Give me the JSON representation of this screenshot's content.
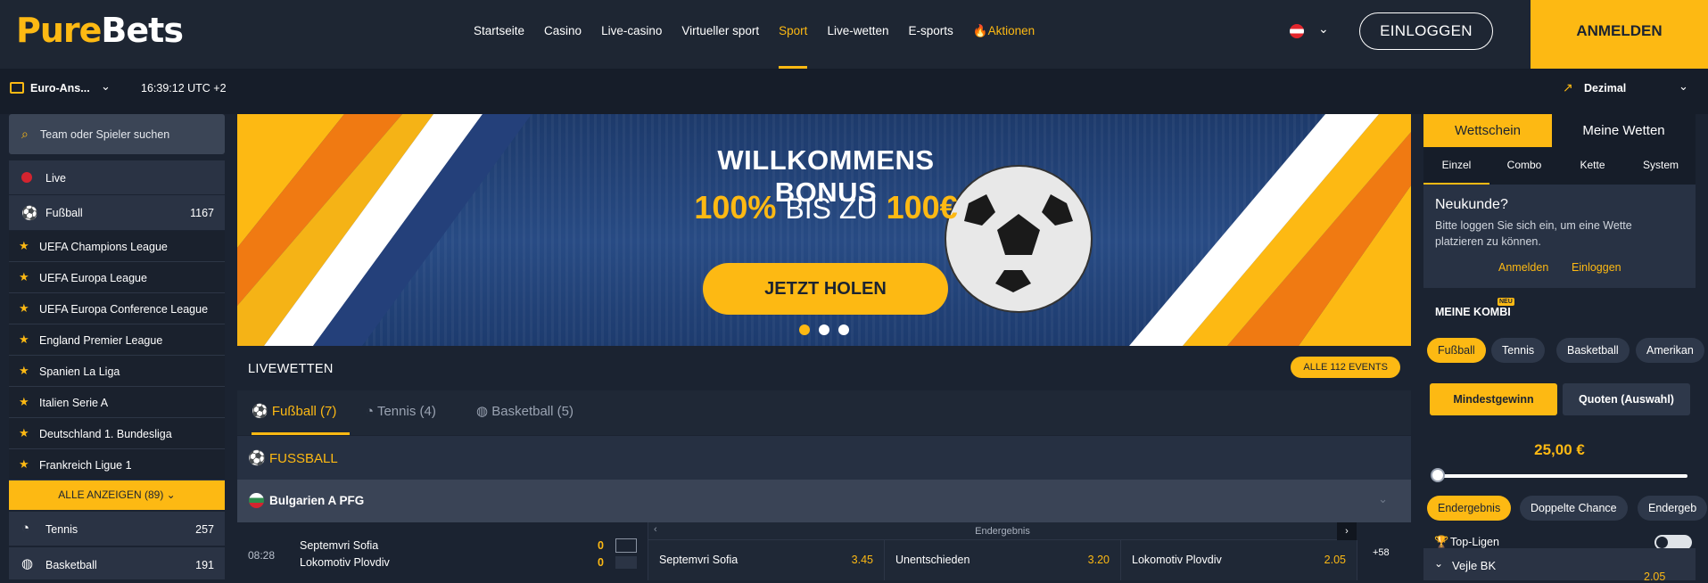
{
  "logo": {
    "part1": "Pure",
    "part2": "Bets"
  },
  "nav": [
    {
      "label": "Startseite"
    },
    {
      "label": "Casino"
    },
    {
      "label": "Live-casino"
    },
    {
      "label": "Virtueller sport"
    },
    {
      "label": "Sport",
      "active": true
    },
    {
      "label": "Live-wetten"
    },
    {
      "label": "E-sports"
    },
    {
      "label": "Aktionen",
      "icon": "fire-icon"
    }
  ],
  "header": {
    "login_label": "EINLOGGEN",
    "signup_label": "ANMELDEN"
  },
  "subbar": {
    "odds_format": "Euro-Ans...",
    "time": "16:39:12 UTC +2",
    "decimal": "Dezimal"
  },
  "sidebar": {
    "search_placeholder": "Team oder Spieler suchen",
    "live_label": "Live",
    "football": {
      "label": "Fußball",
      "count": "1167"
    },
    "leagues": [
      "UEFA Champions League",
      "UEFA Europa League",
      "UEFA Europa Conference League",
      "England Premier League",
      "Spanien La Liga",
      "Italien Serie A",
      "Deutschland 1. Bundesliga",
      "Frankreich Ligue 1"
    ],
    "show_all": "ALLE ANZEIGEN (89)",
    "tennis": {
      "label": "Tennis",
      "count": "257"
    },
    "basketball": {
      "label": "Basketball",
      "count": "191"
    }
  },
  "banner": {
    "title": "WILLKOMMENS BONUS",
    "offer_pct": "100%",
    "offer_mid": "BIS ZU",
    "offer_amount": "100€",
    "cta": "JETZT HOLEN",
    "dots_active": 1
  },
  "live": {
    "title": "LIVEWETTEN",
    "all_events": "ALLE 112 EVENTS",
    "tabs": [
      {
        "label": "Fußball (7)",
        "active": true
      },
      {
        "label": "Tennis (4)"
      },
      {
        "label": "Basketball (5)"
      }
    ],
    "section_title": "FUSSBALL",
    "league": "Bulgarien A PFG",
    "match": {
      "time": "08:28",
      "home": "Septemvri Sofia",
      "away": "Lokomotiv Plovdiv",
      "home_score": "0",
      "away_score": "0",
      "market": "Endergebnis",
      "odds": [
        {
          "name": "Septemvri Sofia",
          "value": "3.45"
        },
        {
          "name": "Unentschieden",
          "value": "3.20"
        },
        {
          "name": "Lokomotiv Plovdiv",
          "value": "2.05"
        }
      ],
      "more": "+58"
    }
  },
  "betslip": {
    "tabs": [
      "Wettschein",
      "Meine Wetten"
    ],
    "subtabs": [
      "Einzel",
      "Combo",
      "Kette",
      "System"
    ],
    "new_customer_title": "Neukunde?",
    "new_customer_text": "Bitte loggen Sie sich ein, um eine Wette platzieren zu können.",
    "link_signup": "Anmelden",
    "link_login": "Einloggen",
    "kombi_title": "MEINE KOMBI",
    "kombi_badge": "NEU",
    "sport_pills": [
      "Fußball",
      "Tennis",
      "Basketball",
      "Amerikan"
    ],
    "btn_min": "Mindestgewinn",
    "btn_odds": "Quoten (Auswahl)",
    "amount": "25,00 €",
    "amount_slider": 0,
    "market_pills": [
      "Endergebnis",
      "Doppelte Chance",
      "Endergeb"
    ],
    "top_leagues": "Top-Ligen",
    "top_leagues_on": false,
    "team": "Vejle BK",
    "team_odds": "2.05"
  },
  "colors": {
    "accent": "#fdb913",
    "bg": "#1b2331",
    "panel": "#2a3344"
  }
}
